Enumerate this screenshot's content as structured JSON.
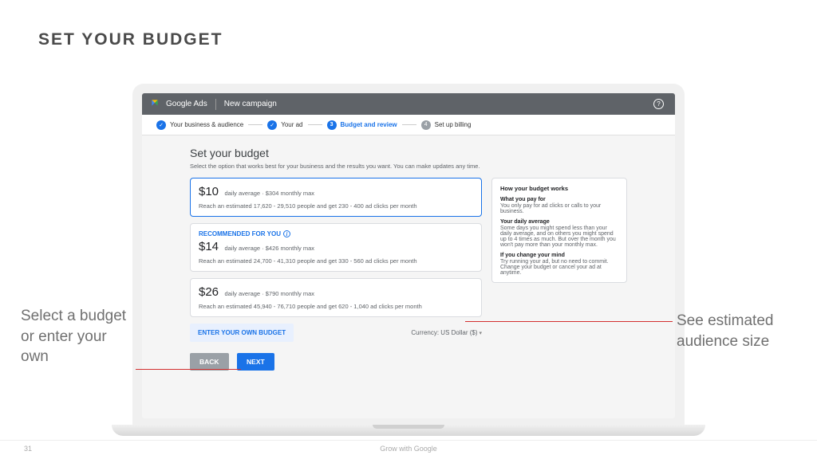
{
  "slide": {
    "title": "SET YOUR BUDGET",
    "page_number": "31",
    "footer": "Grow with Google",
    "callout_left_l1": "Select a budget",
    "callout_left_l2": "or enter your",
    "callout_left_l3": "own",
    "callout_right_l1": "See estimated",
    "callout_right_l2": "audience size"
  },
  "topbar": {
    "brand": "Google Ads",
    "context": "New campaign"
  },
  "steps": {
    "s1": "Your business & audience",
    "s2": "Your ad",
    "s3_num": "3",
    "s3": "Budget and review",
    "s4_num": "4",
    "s4": "Set up billing"
  },
  "content": {
    "title": "Set your budget",
    "subtitle": "Select the option that works best for your business and the results you want. You can make updates any time.",
    "options": [
      {
        "price": "$10",
        "info": "daily average · $304 monthly max",
        "reach": "Reach an estimated 17,620 - 29,510 people and get 230 - 400 ad clicks per month"
      },
      {
        "price": "$14",
        "info": "daily average · $426 monthly max",
        "reach": "Reach an estimated 24,700 - 41,310 people and get 330 - 560 ad clicks per month",
        "reco": "RECOMMENDED FOR YOU"
      },
      {
        "price": "$26",
        "info": "daily average · $790 monthly max",
        "reach": "Reach an estimated 45,940 - 76,710 people and get 620 - 1,040 ad clicks per month"
      }
    ],
    "own_budget": "ENTER YOUR OWN BUDGET",
    "currency": "Currency: US Dollar ($)",
    "back": "BACK",
    "next": "NEXT"
  },
  "infobox": {
    "title": "How your budget works",
    "h1": "What you pay for",
    "p1": "You only pay for ad clicks or calls to your business.",
    "h2": "Your daily average",
    "p2": "Some days you might spend less than your daily average, and on others you might spend up to 4 times as much. But over the month you won't pay more than your monthly max.",
    "h3": "If you change your mind",
    "p3": "Try running your ad, but no need to commit. Change your budget or cancel your ad at anytime."
  }
}
